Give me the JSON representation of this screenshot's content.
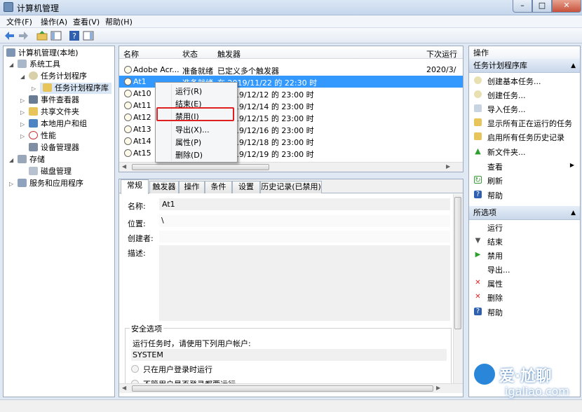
{
  "window": {
    "title": "计算机管理"
  },
  "menu": [
    "文件(F)",
    "操作(A)",
    "查看(V)",
    "帮助(H)"
  ],
  "tree": {
    "root": "计算机管理(本地)",
    "system_tools": "系统工具",
    "task_scheduler": "任务计划程序",
    "task_library": "任务计划程序库",
    "event_viewer": "事件查看器",
    "shared_folders": "共享文件夹",
    "local_users": "本地用户和组",
    "performance": "性能",
    "device_manager": "设备管理器",
    "storage": "存储",
    "disk_management": "磁盘管理",
    "services_apps": "服务和应用程序"
  },
  "list": {
    "columns": [
      "名称",
      "状态",
      "触发器",
      "下次运行"
    ],
    "rows": [
      {
        "name": "Adobe Acr...",
        "status": "准备就绪",
        "trigger": "已定义多个触发器",
        "next": "2020/3/"
      },
      {
        "name": "At1",
        "status": "准备就绪",
        "trigger": "在 2019/11/22 的 22:30 时",
        "next": ""
      },
      {
        "name": "At10",
        "status": "",
        "trigger": "19/12/12 的 23:00 时",
        "next": ""
      },
      {
        "name": "At11",
        "status": "",
        "trigger": "19/12/14 的 23:00 时",
        "next": ""
      },
      {
        "name": "At12",
        "status": "",
        "trigger": "19/12/15 的 23:00 时",
        "next": ""
      },
      {
        "name": "At13",
        "status": "",
        "trigger": "19/12/16 的 23:00 时",
        "next": ""
      },
      {
        "name": "At14",
        "status": "",
        "trigger": "19/12/18 的 23:00 时",
        "next": ""
      },
      {
        "name": "At15",
        "status": "",
        "trigger": "19/12/19 的 23:00 时",
        "next": ""
      }
    ]
  },
  "context_menu": [
    "运行(R)",
    "结束(E)",
    "禁用(I)",
    "导出(X)...",
    "属性(P)",
    "删除(D)"
  ],
  "detail": {
    "tabs": [
      "常规",
      "触发器",
      "操作",
      "条件",
      "设置",
      "历史记录(已禁用)"
    ],
    "name_label": "名称:",
    "name_value": "At1",
    "location_label": "位置:",
    "location_value": "\\",
    "author_label": "创建者:",
    "desc_label": "描述:",
    "security_title": "安全选项",
    "security_run_as": "运行任务时，请使用下列用户帐户:",
    "account": "SYSTEM",
    "radio1": "只在用户登录时运行",
    "radio2": "不管用户是否登录都要运行"
  },
  "actions": {
    "header": "操作",
    "section1": "任务计划程序库",
    "items1": [
      "创建基本任务...",
      "创建任务...",
      "导入任务...",
      "显示所有正在运行的任务",
      "启用所有任务历史记录",
      "新文件夹...",
      "查看",
      "刷新",
      "帮助"
    ],
    "section2": "所选项",
    "items2": [
      "运行",
      "结束",
      "禁用",
      "导出...",
      "属性",
      "删除",
      "帮助"
    ]
  },
  "watermark": {
    "text": "爱·尬聊",
    "url": "igaliao.com"
  }
}
